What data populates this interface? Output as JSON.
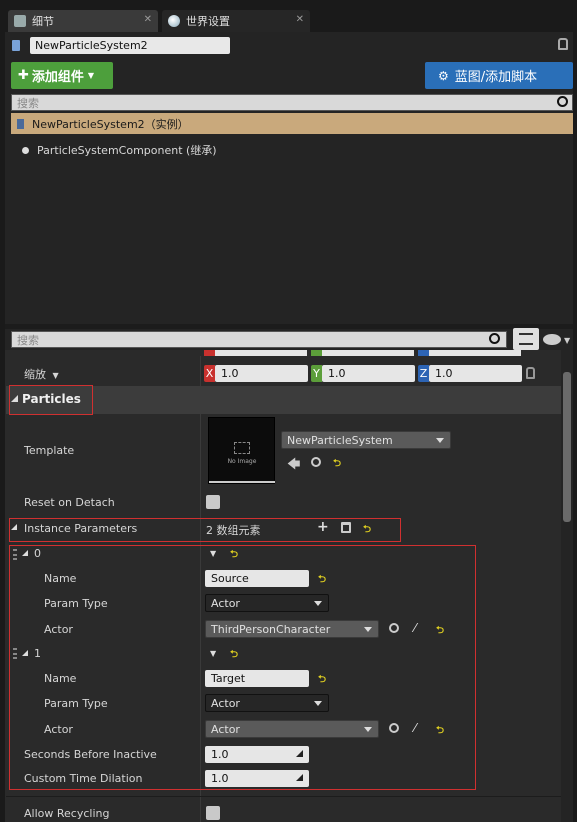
{
  "tabs": [
    {
      "label": "细节",
      "icon": "details-icon"
    },
    {
      "label": "世界设置",
      "icon": "world-icon"
    }
  ],
  "actor_name": "NewParticleSystem2",
  "add_component_label": "添加组件",
  "blueprint_label": "蓝图/添加脚本",
  "component_search_placeholder": "搜索",
  "components": {
    "root": "NewParticleSystem2（实例）",
    "child": "ParticleSystemComponent (继承)"
  },
  "details_search_placeholder": "搜索",
  "scale": {
    "label": "缩放",
    "x": "1.0",
    "y": "1.0",
    "z": "1.0"
  },
  "section_title": "Particles",
  "template": {
    "label": "Template",
    "thumb_text": "No Image",
    "value": "NewParticleSystem"
  },
  "reset_on_detach_label": "Reset on Detach",
  "instance_params": {
    "label": "Instance Parameters",
    "count": "2 数组元素",
    "items": [
      {
        "index": "0",
        "name_label": "Name",
        "name": "Source",
        "type_label": "Param Type",
        "type": "Actor",
        "actor_label": "Actor",
        "actor": "ThirdPersonCharacter"
      },
      {
        "index": "1",
        "name_label": "Name",
        "name": "Target",
        "type_label": "Param Type",
        "type": "Actor",
        "actor_label": "Actor",
        "actor": "Actor"
      }
    ]
  },
  "seconds_before_inactive": {
    "label": "Seconds Before Inactive",
    "value": "1.0"
  },
  "custom_time_dilation": {
    "label": "Custom Time Dilation",
    "value": "1.0"
  },
  "allow_recycling_label": "Allow Recycling",
  "colors": {
    "green_button": "#4d9f3c",
    "blue_button": "#2a6fb8",
    "selected_row": "#c9a97c",
    "highlight_box": "#d03030",
    "axis_x": "#c8312e",
    "axis_y": "#5c9e3a",
    "axis_z": "#2d64b4"
  }
}
